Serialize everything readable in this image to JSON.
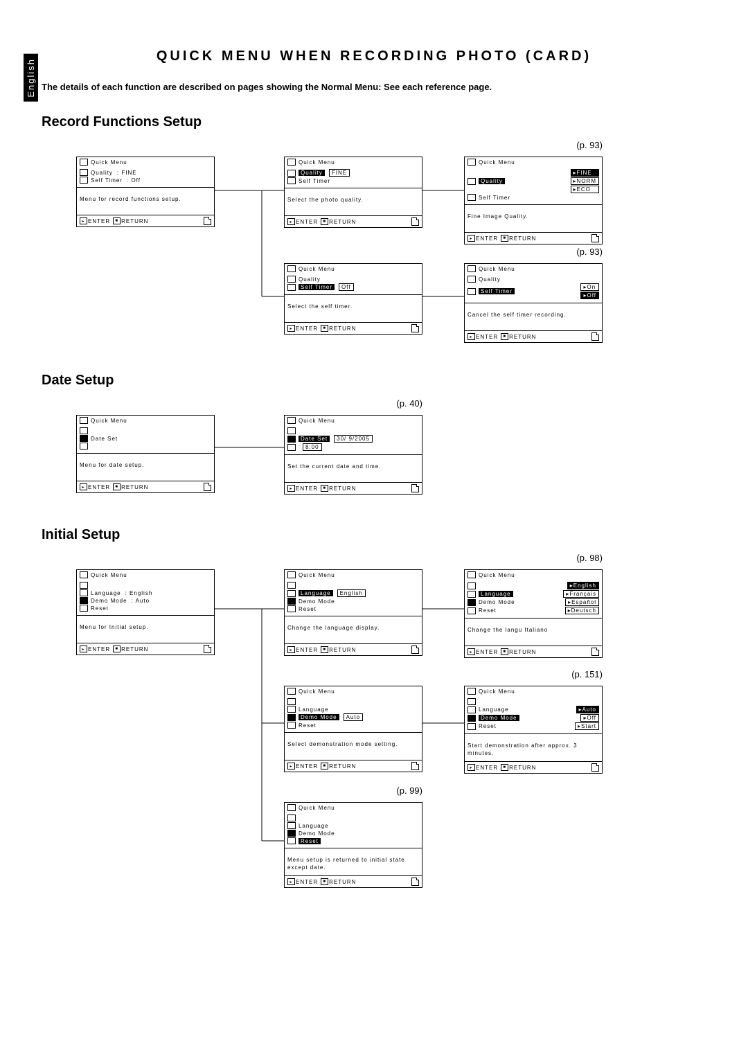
{
  "side_tab": "English",
  "page_title": "QUICK MENU WHEN RECORDING PHOTO (CARD)",
  "intro": "The details of each function are described on pages showing the Normal Menu: See each reference page.",
  "sections": {
    "record": {
      "title": "Record Functions Setup",
      "ref1": "(p. 93)",
      "ref2": "(p. 93)",
      "panels": {
        "r1": {
          "title": "Quick Menu",
          "lines": [
            {
              "label": "Quality",
              "value": ": FINE"
            },
            {
              "label": "Self Timer",
              "value": ": Off"
            }
          ],
          "desc": "Menu for record functions setup.",
          "enter": "ENTER",
          "return": "RETURN"
        },
        "r2": {
          "title": "Quick Menu",
          "lines": [
            {
              "label": "Quality",
              "hl": true,
              "value": "FINE",
              "vbox": true
            },
            {
              "label": "Self Timer"
            }
          ],
          "desc": "Select the photo quality.",
          "enter": "ENTER",
          "return": "RETURN"
        },
        "r3": {
          "title": "Quick Menu",
          "lines": [
            {
              "label": "Quality",
              "hl": true,
              "opts": [
                "FINE",
                "NORM",
                "ECO"
              ],
              "optsel": 0
            },
            {
              "label": "Self Timer"
            }
          ],
          "desc": "Fine Image Quality.",
          "enter": "ENTER",
          "return": "RETURN"
        },
        "r4": {
          "title": "Quick Menu",
          "lines": [
            {
              "label": "Quality"
            },
            {
              "label": "Self Timer",
              "hl": true,
              "value": "Off",
              "vbox": true
            }
          ],
          "desc": "Select the self timer.",
          "enter": "ENTER",
          "return": "RETURN"
        },
        "r5": {
          "title": "Quick Menu",
          "lines": [
            {
              "label": "Quality"
            },
            {
              "label": "Self Timer",
              "hl": true,
              "opts": [
                "On",
                "Off"
              ],
              "optsel": 1
            }
          ],
          "desc": "Cancel the self timer recording.",
          "enter": "ENTER",
          "return": "RETURN"
        }
      }
    },
    "date": {
      "title": "Date Setup",
      "ref1": "(p. 40)",
      "panels": {
        "d1": {
          "title": "Quick Menu",
          "lines": [
            {
              "label": ""
            },
            {
              "label": "Date Set",
              "icfill": true
            },
            {
              "label": ""
            }
          ],
          "desc": "Menu for date setup.",
          "enter": "ENTER",
          "return": "RETURN"
        },
        "d2": {
          "title": "Quick Menu",
          "lines": [
            {
              "label": ""
            },
            {
              "label": "Date Set",
              "hl": true,
              "icfill": true,
              "value": "30/ 9/2005",
              "vbox": true
            },
            {
              "label": "",
              "value": "8:00",
              "vbox": true
            }
          ],
          "desc": "Set the current date and time.",
          "enter": "ENTER",
          "return": "RETURN"
        }
      }
    },
    "init": {
      "title": "Initial Setup",
      "ref1": "(p. 98)",
      "ref2": "(p. 151)",
      "ref3": "(p. 99)",
      "panels": {
        "i1": {
          "title": "Quick Menu",
          "lines": [
            {
              "label": ""
            },
            {
              "label": "Language",
              "value": ": English"
            },
            {
              "label": "Demo Mode",
              "value": ": Auto",
              "icfill": true
            },
            {
              "label": "Reset"
            }
          ],
          "desc": "Menu for Initial setup.",
          "enter": "ENTER",
          "return": "RETURN"
        },
        "i2": {
          "title": "Quick Menu",
          "lines": [
            {
              "label": ""
            },
            {
              "label": "Language",
              "hl": true,
              "value": "English",
              "vbox": true
            },
            {
              "label": "Demo Mode",
              "icfill": true
            },
            {
              "label": "Reset"
            }
          ],
          "desc": "Change the language display.",
          "enter": "ENTER",
          "return": "RETURN"
        },
        "i3": {
          "title": "Quick Menu",
          "lines": [
            {
              "label": "",
              "opts": [
                "English"
              ],
              "optsel": 0
            },
            {
              "label": "Language",
              "hl": true,
              "opts": [
                "Français"
              ]
            },
            {
              "label": "Demo Mode",
              "opts": [
                "Español"
              ],
              "icfill": true
            },
            {
              "label": "Reset",
              "opts": [
                "Deutsch"
              ]
            }
          ],
          "desc": "Change the langu   Italiano",
          "enter": "ENTER",
          "return": "RETURN"
        },
        "i4": {
          "title": "Quick Menu",
          "lines": [
            {
              "label": ""
            },
            {
              "label": "Language"
            },
            {
              "label": "Demo Mode",
              "hl": true,
              "value": "Auto",
              "vbox": true,
              "icfill": true
            },
            {
              "label": "Reset"
            }
          ],
          "desc": "Select demonstration mode setting.",
          "enter": "ENTER",
          "return": "RETURN"
        },
        "i5": {
          "title": "Quick Menu",
          "lines": [
            {
              "label": ""
            },
            {
              "label": "Language",
              "opts": [
                "Auto"
              ],
              "optsel": 0
            },
            {
              "label": "Demo Mode",
              "hl": true,
              "opts": [
                "Off"
              ],
              "icfill": true
            },
            {
              "label": "Reset",
              "opts": [
                "Start"
              ]
            }
          ],
          "desc": "Start demonstration after approx. 3 minutes.",
          "enter": "ENTER",
          "return": "RETURN"
        },
        "i6": {
          "title": "Quick Menu",
          "lines": [
            {
              "label": ""
            },
            {
              "label": "Language"
            },
            {
              "label": "Demo Mode",
              "icfill": true
            },
            {
              "label": "Reset",
              "hl": true
            }
          ],
          "desc": "Menu setup is returned to initial state except date.",
          "enter": "ENTER",
          "return": "RETURN"
        }
      }
    }
  }
}
